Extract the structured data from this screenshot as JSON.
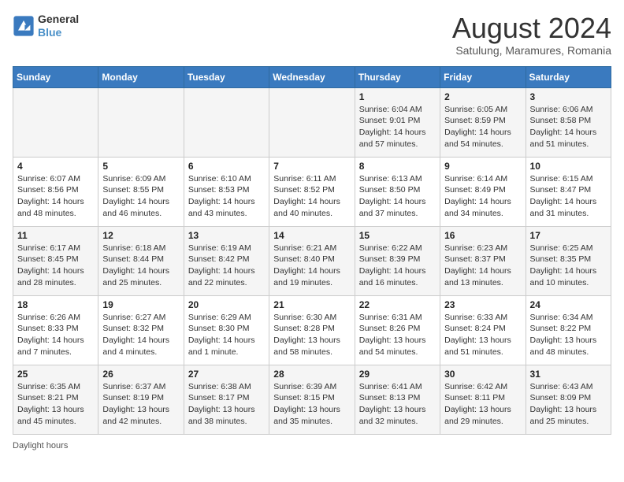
{
  "header": {
    "logo_general": "General",
    "logo_blue": "Blue",
    "main_title": "August 2024",
    "subtitle": "Satulung, Maramures, Romania"
  },
  "days_of_week": [
    "Sunday",
    "Monday",
    "Tuesday",
    "Wednesday",
    "Thursday",
    "Friday",
    "Saturday"
  ],
  "weeks": [
    [
      {
        "num": "",
        "info": ""
      },
      {
        "num": "",
        "info": ""
      },
      {
        "num": "",
        "info": ""
      },
      {
        "num": "",
        "info": ""
      },
      {
        "num": "1",
        "info": "Sunrise: 6:04 AM\nSunset: 9:01 PM\nDaylight: 14 hours and 57 minutes."
      },
      {
        "num": "2",
        "info": "Sunrise: 6:05 AM\nSunset: 8:59 PM\nDaylight: 14 hours and 54 minutes."
      },
      {
        "num": "3",
        "info": "Sunrise: 6:06 AM\nSunset: 8:58 PM\nDaylight: 14 hours and 51 minutes."
      }
    ],
    [
      {
        "num": "4",
        "info": "Sunrise: 6:07 AM\nSunset: 8:56 PM\nDaylight: 14 hours and 48 minutes."
      },
      {
        "num": "5",
        "info": "Sunrise: 6:09 AM\nSunset: 8:55 PM\nDaylight: 14 hours and 46 minutes."
      },
      {
        "num": "6",
        "info": "Sunrise: 6:10 AM\nSunset: 8:53 PM\nDaylight: 14 hours and 43 minutes."
      },
      {
        "num": "7",
        "info": "Sunrise: 6:11 AM\nSunset: 8:52 PM\nDaylight: 14 hours and 40 minutes."
      },
      {
        "num": "8",
        "info": "Sunrise: 6:13 AM\nSunset: 8:50 PM\nDaylight: 14 hours and 37 minutes."
      },
      {
        "num": "9",
        "info": "Sunrise: 6:14 AM\nSunset: 8:49 PM\nDaylight: 14 hours and 34 minutes."
      },
      {
        "num": "10",
        "info": "Sunrise: 6:15 AM\nSunset: 8:47 PM\nDaylight: 14 hours and 31 minutes."
      }
    ],
    [
      {
        "num": "11",
        "info": "Sunrise: 6:17 AM\nSunset: 8:45 PM\nDaylight: 14 hours and 28 minutes."
      },
      {
        "num": "12",
        "info": "Sunrise: 6:18 AM\nSunset: 8:44 PM\nDaylight: 14 hours and 25 minutes."
      },
      {
        "num": "13",
        "info": "Sunrise: 6:19 AM\nSunset: 8:42 PM\nDaylight: 14 hours and 22 minutes."
      },
      {
        "num": "14",
        "info": "Sunrise: 6:21 AM\nSunset: 8:40 PM\nDaylight: 14 hours and 19 minutes."
      },
      {
        "num": "15",
        "info": "Sunrise: 6:22 AM\nSunset: 8:39 PM\nDaylight: 14 hours and 16 minutes."
      },
      {
        "num": "16",
        "info": "Sunrise: 6:23 AM\nSunset: 8:37 PM\nDaylight: 14 hours and 13 minutes."
      },
      {
        "num": "17",
        "info": "Sunrise: 6:25 AM\nSunset: 8:35 PM\nDaylight: 14 hours and 10 minutes."
      }
    ],
    [
      {
        "num": "18",
        "info": "Sunrise: 6:26 AM\nSunset: 8:33 PM\nDaylight: 14 hours and 7 minutes."
      },
      {
        "num": "19",
        "info": "Sunrise: 6:27 AM\nSunset: 8:32 PM\nDaylight: 14 hours and 4 minutes."
      },
      {
        "num": "20",
        "info": "Sunrise: 6:29 AM\nSunset: 8:30 PM\nDaylight: 14 hours and 1 minute."
      },
      {
        "num": "21",
        "info": "Sunrise: 6:30 AM\nSunset: 8:28 PM\nDaylight: 13 hours and 58 minutes."
      },
      {
        "num": "22",
        "info": "Sunrise: 6:31 AM\nSunset: 8:26 PM\nDaylight: 13 hours and 54 minutes."
      },
      {
        "num": "23",
        "info": "Sunrise: 6:33 AM\nSunset: 8:24 PM\nDaylight: 13 hours and 51 minutes."
      },
      {
        "num": "24",
        "info": "Sunrise: 6:34 AM\nSunset: 8:22 PM\nDaylight: 13 hours and 48 minutes."
      }
    ],
    [
      {
        "num": "25",
        "info": "Sunrise: 6:35 AM\nSunset: 8:21 PM\nDaylight: 13 hours and 45 minutes."
      },
      {
        "num": "26",
        "info": "Sunrise: 6:37 AM\nSunset: 8:19 PM\nDaylight: 13 hours and 42 minutes."
      },
      {
        "num": "27",
        "info": "Sunrise: 6:38 AM\nSunset: 8:17 PM\nDaylight: 13 hours and 38 minutes."
      },
      {
        "num": "28",
        "info": "Sunrise: 6:39 AM\nSunset: 8:15 PM\nDaylight: 13 hours and 35 minutes."
      },
      {
        "num": "29",
        "info": "Sunrise: 6:41 AM\nSunset: 8:13 PM\nDaylight: 13 hours and 32 minutes."
      },
      {
        "num": "30",
        "info": "Sunrise: 6:42 AM\nSunset: 8:11 PM\nDaylight: 13 hours and 29 minutes."
      },
      {
        "num": "31",
        "info": "Sunrise: 6:43 AM\nSunset: 8:09 PM\nDaylight: 13 hours and 25 minutes."
      }
    ]
  ],
  "footer": {
    "note": "Daylight hours"
  }
}
